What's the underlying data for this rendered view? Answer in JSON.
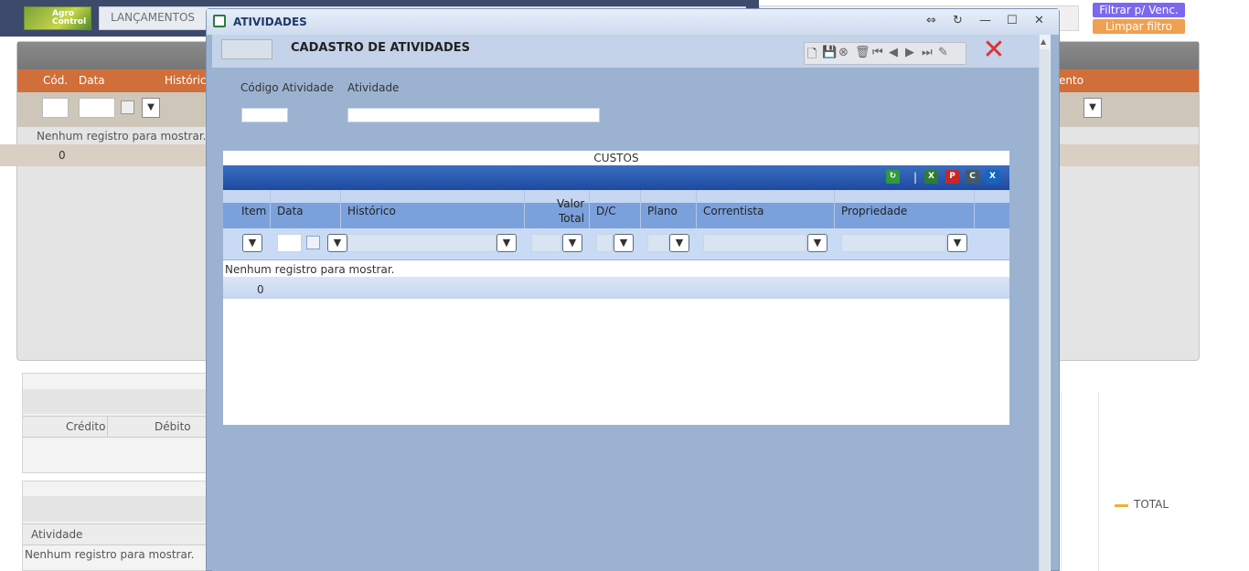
{
  "app": {
    "menu_item": "LANÇAMENTOS",
    "logo_text": "Agro Control",
    "filtrar_button": "Filtrar p/ Venc.",
    "limpar_button": "Limpar filtro"
  },
  "background_grid": {
    "columns": [
      "Cód.",
      "Data",
      "Histórico",
      "ento"
    ],
    "empty_message": "Nenhum registro para mostrar.",
    "count": "0"
  },
  "lower_panel1": {
    "columns": [
      "Crédito",
      "Débito"
    ]
  },
  "lower_panel2": {
    "columns": [
      "Atividade"
    ],
    "empty_message": "Nenhum registro para mostrar."
  },
  "legend": {
    "label": "TOTAL",
    "color": "#f0b030"
  },
  "modal": {
    "window_title": "ATIVIDADES",
    "form_title": "CADASTRO DE ATIVIDADES",
    "fields": {
      "codigo_label": "Código Atividade",
      "atividade_label": "Atividade",
      "codigo_value": "",
      "atividade_value": ""
    },
    "custos": {
      "title": "CUSTOS",
      "columns": [
        "Item",
        "Data",
        "Histórico",
        "Valor",
        "Total",
        "D/C",
        "Plano",
        "Correntista",
        "Propriedade"
      ],
      "empty_message": "Nenhum registro para mostrar.",
      "count": "0"
    }
  }
}
